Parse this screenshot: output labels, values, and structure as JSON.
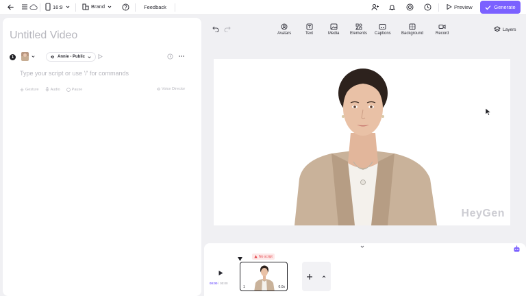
{
  "topbar": {
    "aspect_ratio": "16:9",
    "brand_label": "Brand",
    "feedback_label": "Feedback",
    "preview_label": "Preview",
    "generate_label": "Generate"
  },
  "editor": {
    "title_placeholder": "Untitled Video",
    "scene_number": "1",
    "voice_label": "Annie - Public",
    "script_placeholder": "Type your script or use '/' for commands",
    "tools": {
      "gesture": "Gesture",
      "audio": "Audio",
      "pause": "Pause"
    },
    "voice_director_label": "Voice Director"
  },
  "canvas_toolbar": {
    "tools": [
      {
        "label": "Avatars",
        "icon": "avatar-icon"
      },
      {
        "label": "Text",
        "icon": "text-icon"
      },
      {
        "label": "Media",
        "icon": "media-icon"
      },
      {
        "label": "Elements",
        "icon": "elements-icon"
      },
      {
        "label": "Captions",
        "icon": "captions-icon"
      },
      {
        "label": "Background",
        "icon": "background-icon"
      },
      {
        "label": "Record",
        "icon": "record-icon"
      }
    ],
    "layers_label": "Layers"
  },
  "canvas": {
    "watermark": "HeyGen"
  },
  "timeline": {
    "current_time": "00:00",
    "total_time": "/ 00:00",
    "scene_warning": "No script",
    "scene_number": "1",
    "scene_duration": "0.0s"
  },
  "colors": {
    "accent": "#7b61ff",
    "warning": "#e5484d"
  }
}
